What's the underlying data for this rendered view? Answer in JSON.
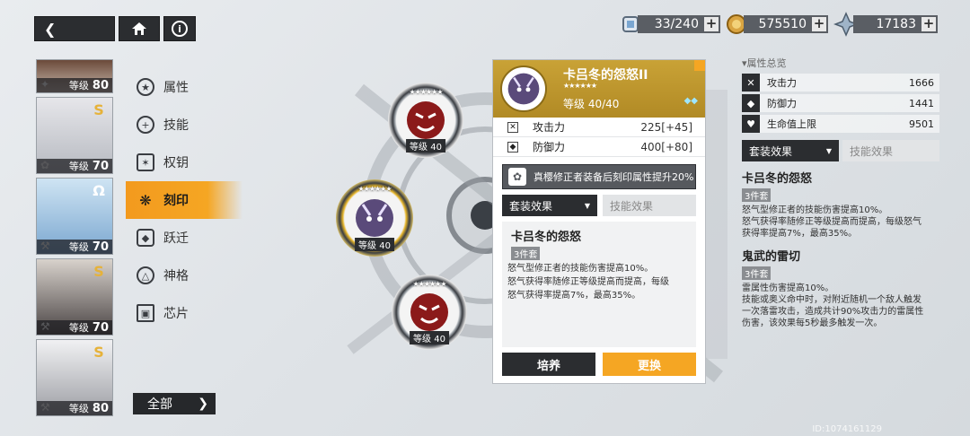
{
  "topbar": {
    "currencies": [
      {
        "icon": "stamina-icon",
        "value": "33/240"
      },
      {
        "icon": "coin-icon",
        "value": "575510"
      },
      {
        "icon": "crystal-icon",
        "value": "17183"
      }
    ],
    "plus": "+"
  },
  "characters": [
    {
      "level_label": "等级",
      "level": "80"
    },
    {
      "level_label": "等级",
      "level": "70"
    },
    {
      "level_label": "等级",
      "level": "70"
    },
    {
      "level_label": "等级",
      "level": "70"
    },
    {
      "level_label": "等级",
      "level": "80"
    }
  ],
  "nav": {
    "items": [
      {
        "label": "属性"
      },
      {
        "label": "技能"
      },
      {
        "label": "权钥"
      },
      {
        "label": "刻印"
      },
      {
        "label": "跃迁"
      },
      {
        "label": "神格"
      },
      {
        "label": "芯片"
      }
    ],
    "active_index": 3,
    "all_button": "全部"
  },
  "nodes": {
    "top": {
      "level": "等级 40"
    },
    "middle": {
      "level": "等级 40"
    },
    "bottom": {
      "level": "等级 40"
    }
  },
  "card": {
    "title": "卡吕冬的怨怒II",
    "level": "等级 40/40",
    "stats": [
      {
        "name": "攻击力",
        "value": "225[+45]"
      },
      {
        "name": "防御力",
        "value": "400[+80]"
      }
    ],
    "bonus": "真樱修正者装备后刻印属性提升20%",
    "tab_selected": "套装效果",
    "tab_other": "技能效果",
    "effect_name": "卡吕冬的怨怒",
    "effect_tag": "3件套",
    "effect_lines": [
      "怒气型修正者的技能伤害提高10%。",
      "怒气获得率随修正等级提高而提高，每级",
      "怒气获得率提高7%，最高35%。"
    ],
    "btn_train": "培养",
    "btn_replace": "更换"
  },
  "panel": {
    "title": "▾属性总览",
    "attrs": [
      {
        "name": "攻击力",
        "value": "1666"
      },
      {
        "name": "防御力",
        "value": "1441"
      },
      {
        "name": "生命值上限",
        "value": "9501"
      }
    ],
    "tab_selected": "套装效果",
    "tab_other": "技能效果",
    "effects": [
      {
        "name": "卡吕冬的怨怒",
        "tag": "3件套",
        "lines": [
          "怒气型修正者的技能伤害提高10%。",
          "怒气获得率随修正等级提高而提高，每级怒气",
          "获得率提高7%，最高35%。"
        ]
      },
      {
        "name": "鬼武的雷切",
        "tag": "3件套",
        "lines": [
          "雷属性伤害提高10%。",
          "技能或奥义命中时，对附近随机一个敌人触发",
          "一次落雷攻击，造成共计90%攻击力的雷属性",
          "伤害，该效果每5秒最多触发一次。"
        ]
      }
    ]
  },
  "uid": "ID:1074161129"
}
